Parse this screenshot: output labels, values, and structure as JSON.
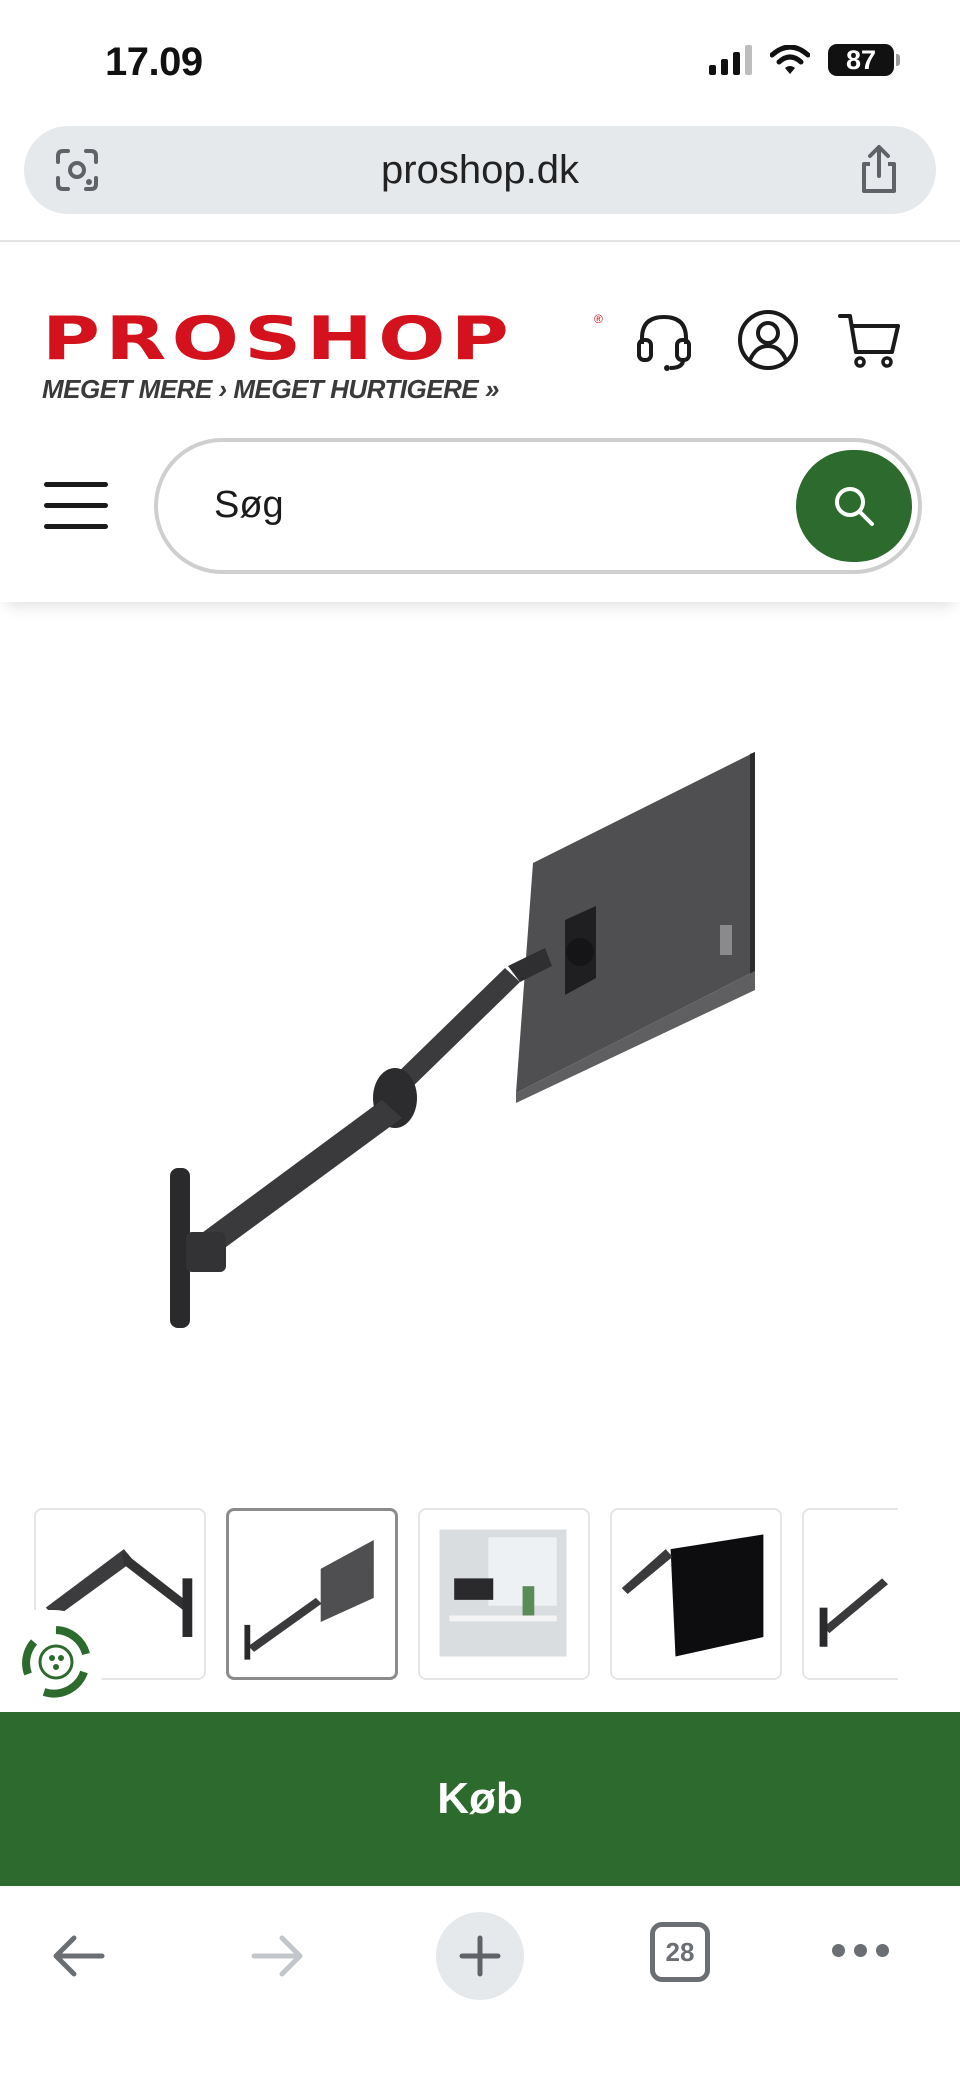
{
  "status_bar": {
    "time": "17.09",
    "battery": "87"
  },
  "browser": {
    "url": "proshop.dk",
    "tab_count": "28"
  },
  "site": {
    "logo_text": "PROSHOP",
    "logo_registered": "®",
    "tagline": "MEGET MERE › MEGET HURTIGERE »",
    "search_placeholder": "Søg",
    "brand_color": "#d4121d",
    "accent_color": "#2d6a2e"
  },
  "product": {
    "image": "monitor-wall-arm-image",
    "thumbnails": [
      {
        "name": "thumb-arm-closeup",
        "selected": false
      },
      {
        "name": "thumb-arm-with-monitor",
        "selected": true
      },
      {
        "name": "thumb-room-scene",
        "selected": false
      },
      {
        "name": "thumb-arm-black-monitor",
        "selected": false
      },
      {
        "name": "thumb-arm-partial",
        "selected": false
      }
    ]
  },
  "buy_button": {
    "label": "Køb"
  },
  "icons": {
    "support": "headset-icon",
    "account": "user-icon",
    "cart": "cart-icon",
    "menu": "hamburger-icon",
    "search": "search-icon",
    "lens": "google-lens-icon",
    "share": "share-icon",
    "back": "arrow-left-icon",
    "forward": "arrow-right-icon",
    "new_tab": "plus-icon",
    "more": "more-dots-icon",
    "eco": "eco-recycle-icon"
  }
}
